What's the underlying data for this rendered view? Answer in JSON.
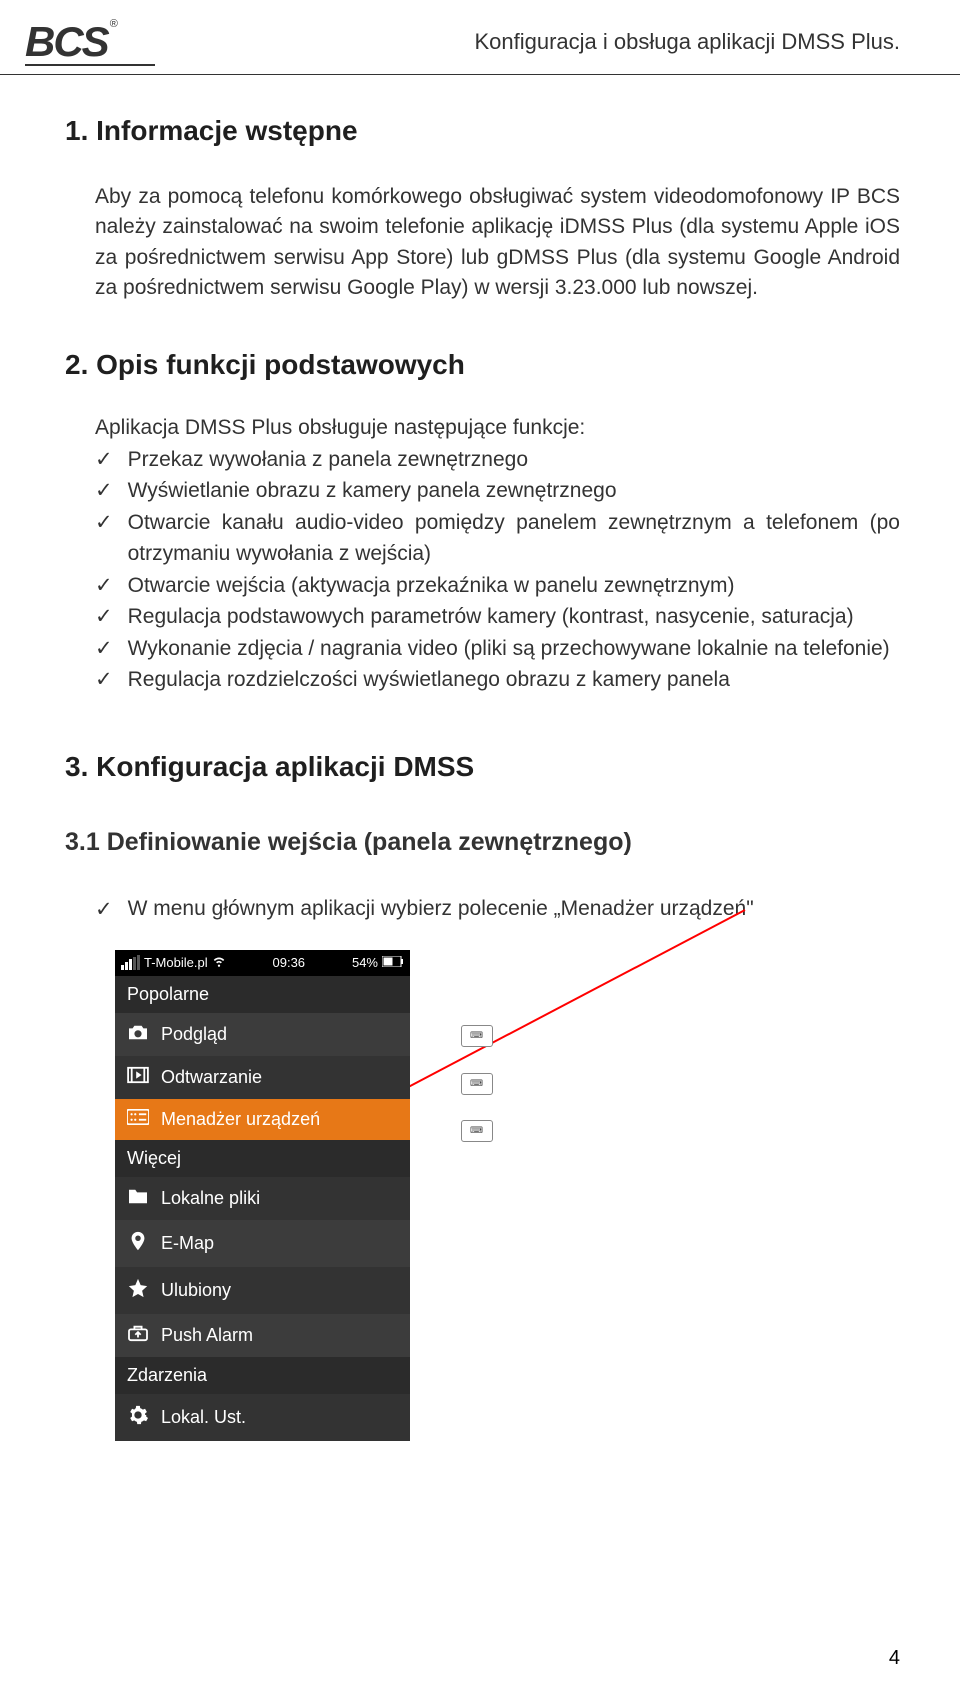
{
  "header": {
    "logo_text": "BCS",
    "trademark": "®",
    "doc_title": "Konfiguracja i obsługa aplikacji DMSS Plus."
  },
  "section1": {
    "heading": "1. Informacje wstępne",
    "paragraph": "Aby za pomocą telefonu komórkowego obsługiwać system videodomofonowy IP BCS należy zainstalować na swoim telefonie aplikację iDMSS Plus (dla systemu Apple iOS za pośrednictwem serwisu App Store) lub gDMSS Plus (dla systemu Google Android za pośrednictwem serwisu Google Play) w wersji 3.23.000 lub nowszej."
  },
  "section2": {
    "heading": "2. Opis funkcji podstawowych",
    "intro": "Aplikacja DMSS Plus obsługuje następujące funkcje:",
    "items": [
      "Przekaz wywołania z panela zewnętrznego",
      "Wyświetlanie obrazu z kamery panela zewnętrznego",
      "Otwarcie kanału audio-video pomiędzy panelem zewnętrznym a telefonem (po otrzymaniu wywołania z wejścia)",
      "Otwarcie wejścia (aktywacja przekaźnika w panelu zewnętrznym)",
      "Regulacja podstawowych parametrów kamery (kontrast, nasycenie, saturacja)",
      "Wykonanie zdjęcia / nagrania video (pliki są przechowywane lokalnie na telefonie)",
      "Regulacja rozdzielczości wyświetlanego obrazu z kamery panela"
    ]
  },
  "section3": {
    "heading": "3. Konfiguracja aplikacji DMSS",
    "sub_heading": "3.1 Definiowanie wejścia (panela zewnętrznego)",
    "instruction": "W menu głównym aplikacji wybierz polecenie „Menadżer urządzeń\""
  },
  "phone": {
    "carrier": "T-Mobile.pl",
    "time": "09:36",
    "battery": "54%",
    "sections": {
      "popular": "Popolarne",
      "more": "Więcej"
    },
    "menu": {
      "preview": "Podgląd",
      "playback": "Odtwarzanie",
      "device_manager": "Menadżer urządzeń",
      "local_files": "Lokalne pliki",
      "emap": "E-Map",
      "favorite": "Ulubiony",
      "push_alarm": "Push Alarm",
      "events": "Zdarzenia",
      "local_settings": "Lokal. Ust."
    }
  },
  "page_number": "4"
}
